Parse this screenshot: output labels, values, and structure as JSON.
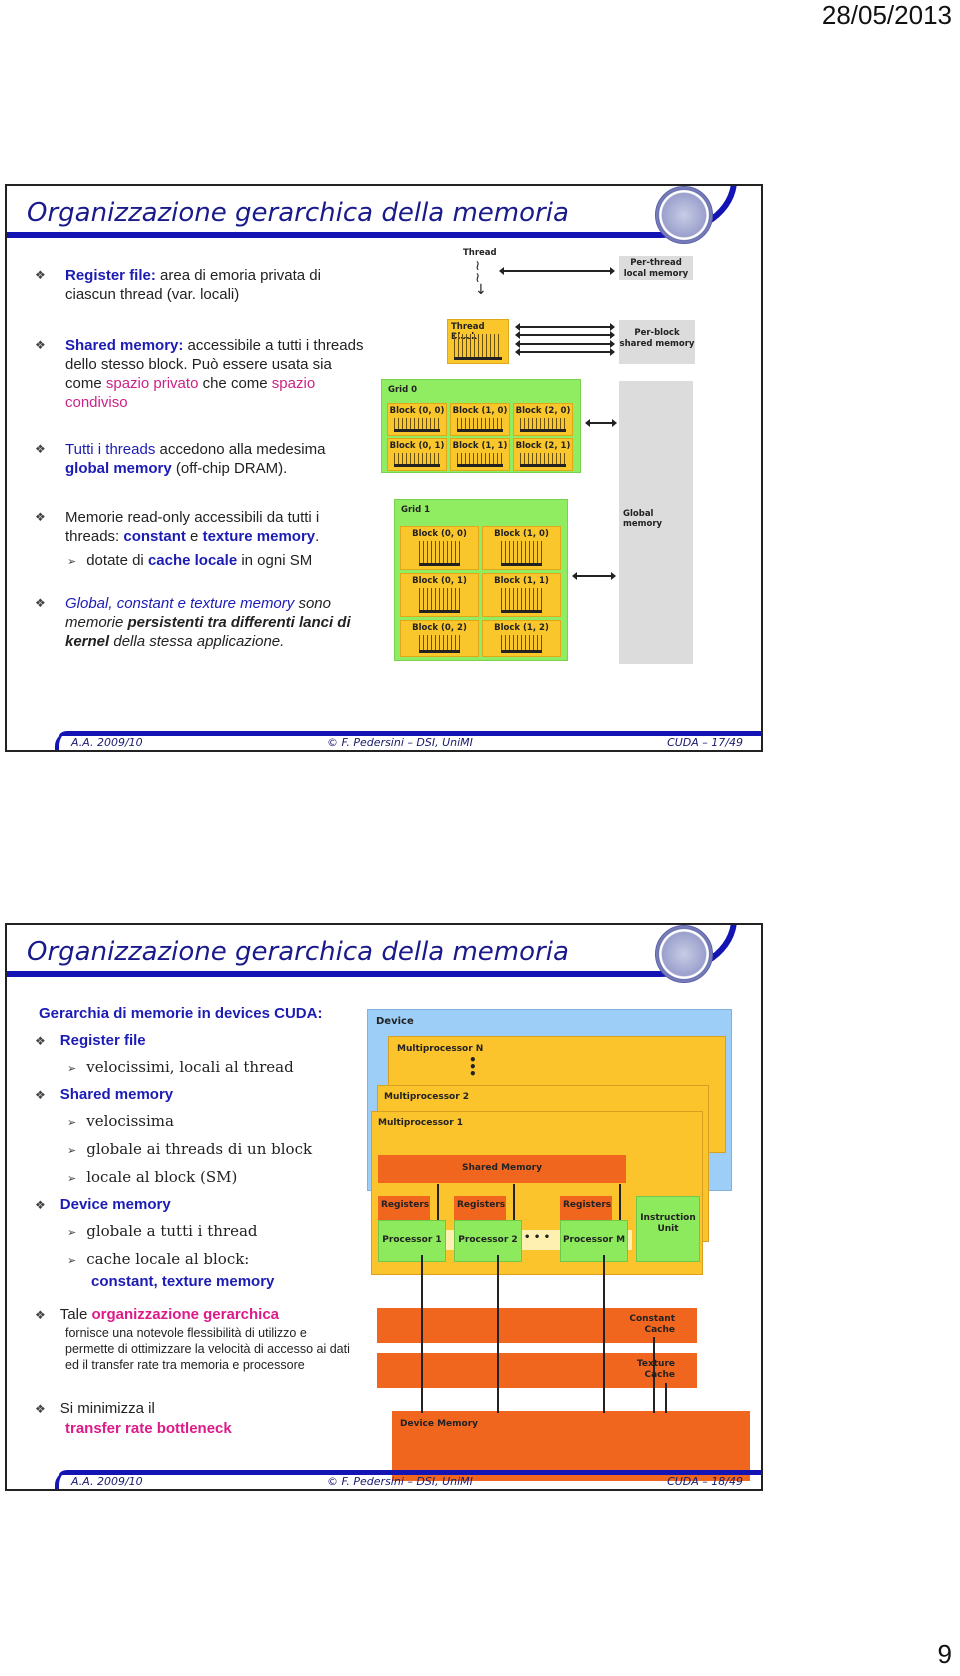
{
  "page": {
    "date": "28/05/2013",
    "page_number": "9"
  },
  "slides": [
    {
      "title": "Organizzazione gerarchica della memoria",
      "bullets": {
        "b1": {
          "bold": "Register file:",
          "rest": " area di emoria privata di ciascun thread (var. locali)"
        },
        "b2": {
          "bold": "Shared memory:",
          "rest": " accessibile a tutti i threads dello stesso block. Può essere usata sia come ",
          "pink1": "spazio privato",
          "mid": " che come ",
          "pink2": "spazio condiviso"
        },
        "b3": {
          "blue": "Tutti i threads",
          "rest": " accedono alla medesima ",
          "bold": "global memory",
          "tail": " (off-chip DRAM)."
        },
        "b4": {
          "pre": "Memorie read-only accessibili da tutti i threads: ",
          "bold1": "constant",
          "mid": " e ",
          "bold2": "texture memory",
          "tail": ".",
          "sub_pre": "dotate di ",
          "sub_bold": "cache locale",
          "sub_tail": " in ogni SM"
        },
        "b5": {
          "blue": "Global, constant e texture memory",
          "pre": " sono memorie ",
          "bold": "persistenti tra differenti lanci di kernel",
          "tail": " della stessa applicazione."
        }
      },
      "diagram": {
        "thread": "Thread",
        "per_thread": "Per-thread local memory",
        "thread_block": "Thread Block",
        "per_block": "Per-block shared memory",
        "grid0": "Grid 0",
        "grid0_blocks": [
          "Block (0, 0)",
          "Block (1, 0)",
          "Block (2, 0)",
          "Block (0, 1)",
          "Block (1, 1)",
          "Block (2, 1)"
        ],
        "grid1": "Grid 1",
        "grid1_blocks": [
          "Block (0, 0)",
          "Block (1, 0)",
          "Block (0, 1)",
          "Block (1, 1)",
          "Block (0, 2)",
          "Block (1, 2)"
        ],
        "global": "Global memory"
      },
      "footer": {
        "left": "A.A. 2009/10",
        "center": "©     F. Pedersini – DSI, UniMI",
        "right": "CUDA –  17/49"
      }
    },
    {
      "title": "Organizzazione gerarchica della memoria",
      "heading": "Gerarchia di memorie in devices CUDA:",
      "items": {
        "reg": "Register file",
        "reg_sub": "velocissimi, locali al thread",
        "shared": "Shared memory",
        "shared_sub": [
          "velocissima",
          "globale ai threads di un block",
          "locale al block (SM)"
        ],
        "device": "Device memory",
        "device_sub1": "globale a tutti i thread",
        "device_sub2": "cache locale al block:",
        "device_sub2_bold": "constant, texture memory"
      },
      "b_tale": {
        "pre": "Tale ",
        "pink": "organizzazione gerarchica",
        "small": "fornisce una notevole flessibilità di utilizzo e permette di ottimizzare la velocità di accesso ai dati ed il transfer rate tra memoria e processore"
      },
      "b_min": {
        "pre": "Si minimizza il",
        "pink": "transfer rate bottleneck"
      },
      "diagram": {
        "device": "Device",
        "mpN": "Multiprocessor N",
        "mp2": "Multiprocessor 2",
        "mp1": "Multiprocessor 1",
        "shared": "Shared Memory",
        "registers": "Registers",
        "p1": "Processor 1",
        "p2": "Processor 2",
        "pm": "Processor M",
        "dots": "• • •",
        "iu": "Instruction Unit",
        "cc": "Constant Cache",
        "tc": "Texture Cache",
        "dm": "Device Memory"
      },
      "footer": {
        "left": "A.A. 2009/10",
        "center": "©     F. Pedersini – DSI, UniMI",
        "right": "CUDA –  18/49"
      }
    }
  ]
}
